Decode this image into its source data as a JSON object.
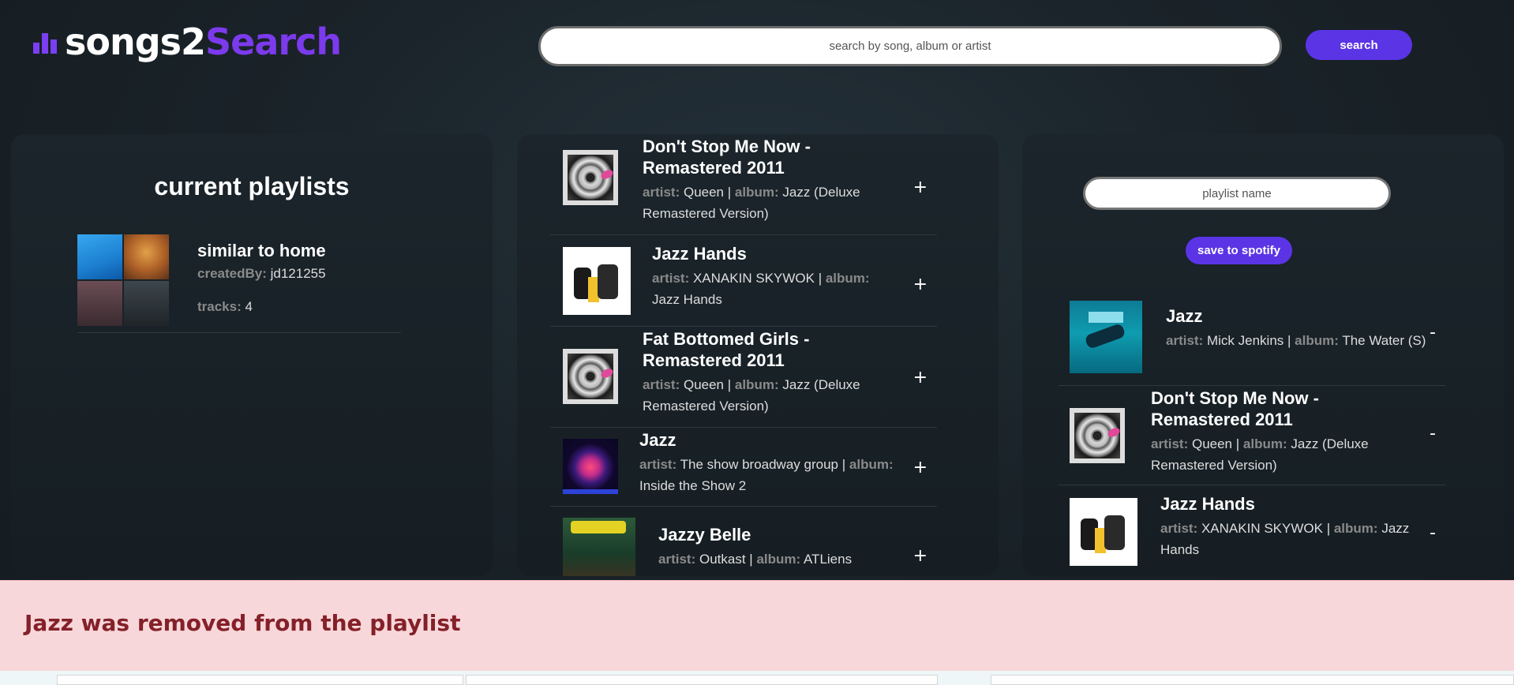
{
  "app": {
    "logo_part1": "songs2",
    "logo_part2": "Search"
  },
  "search": {
    "placeholder": "search by song, album or artist",
    "button_label": "search"
  },
  "playlists_panel": {
    "title": "current playlists",
    "playlists": [
      {
        "name": "similar to home",
        "created_by_label": "createdBy:",
        "created_by": "jd121255",
        "tracks_label": "tracks:",
        "tracks": "4"
      }
    ]
  },
  "search_results": [
    {
      "title": "Don't Stop Me Now - Remastered 2011",
      "artist_label": "artist:",
      "artist": "Queen",
      "album_label": "album:",
      "album": "Jazz (Deluxe Remastered Version)",
      "separator": "|",
      "action": "+",
      "art_icon": "vinyl-record-art"
    },
    {
      "title": "Jazz Hands",
      "artist_label": "artist:",
      "artist": "XANAKIN SKYWOK",
      "album_label": "album:",
      "album": "Jazz Hands",
      "separator": "|",
      "action": "+",
      "art_icon": "cartoon-figures-art"
    },
    {
      "title": "Fat Bottomed Girls - Remastered 2011",
      "artist_label": "artist:",
      "artist": "Queen",
      "album_label": "album:",
      "album": "Jazz (Deluxe Remastered Version)",
      "separator": "|",
      "action": "+",
      "art_icon": "vinyl-record-art"
    },
    {
      "title": "Jazz",
      "artist_label": "artist:",
      "artist": "The show broadway group",
      "album_label": "album:",
      "album": "Inside the Show 2",
      "separator": "|",
      "action": "+",
      "art_icon": "glowing-globe-art"
    },
    {
      "title": "Jazzy Belle",
      "artist_label": "artist:",
      "artist": "Outkast",
      "album_label": "album:",
      "album": "ATLiens",
      "separator": "|",
      "action": "+",
      "art_icon": "outkast-cover-art"
    }
  ],
  "new_playlist": {
    "name_placeholder": "playlist name",
    "save_label": "save to spotify",
    "tracks": [
      {
        "title": "Jazz",
        "artist_label": "artist:",
        "artist": "Mick Jenkins",
        "album_label": "album:",
        "album": "The Water (S)",
        "separator": "|",
        "action": "-",
        "art_icon": "water-cover-art"
      },
      {
        "title": "Don't Stop Me Now - Remastered 2011",
        "artist_label": "artist:",
        "artist": "Queen",
        "album_label": "album:",
        "album": "Jazz (Deluxe Remastered Version)",
        "separator": "|",
        "action": "-",
        "art_icon": "vinyl-record-art"
      },
      {
        "title": "Jazz Hands",
        "artist_label": "artist:",
        "artist": "XANAKIN SKYWOK",
        "album_label": "album:",
        "album": "Jazz Hands",
        "separator": "|",
        "action": "-",
        "art_icon": "cartoon-figures-art"
      }
    ]
  },
  "alert": {
    "message": "Jazz was removed from the playlist"
  },
  "colors": {
    "accent": "#5b34e6",
    "logo_accent": "#7c3aed",
    "alert_bg": "#f8d7da",
    "alert_text": "#842029"
  }
}
